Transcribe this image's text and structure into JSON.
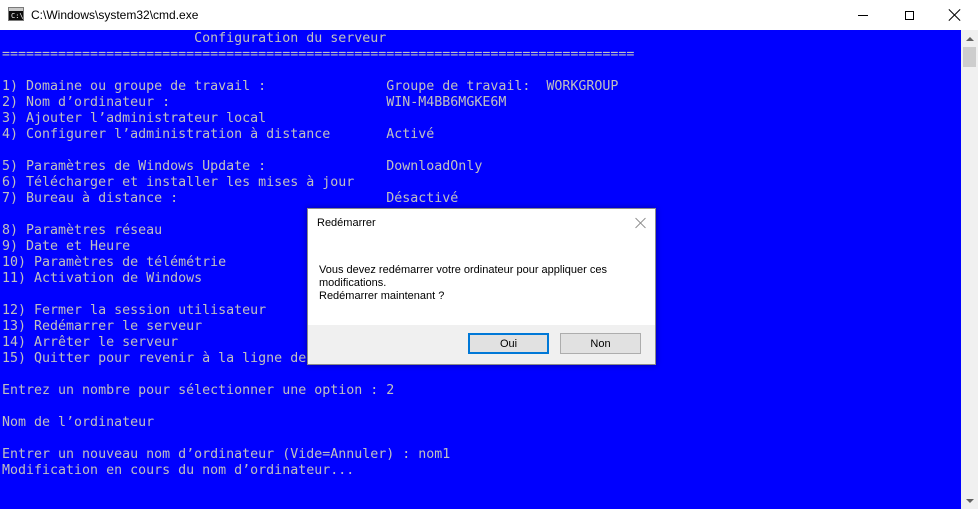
{
  "window": {
    "title": "C:\\Windows\\system32\\cmd.exe",
    "icon": "cmd-console-icon",
    "icon_text": "C:\\."
  },
  "console": {
    "background": "#0000ff",
    "foreground": "#c0c0c0",
    "lines": [
      {
        "row": 0,
        "text": "                        Configuration du serveur"
      },
      {
        "row": 1,
        "text": "==============================================================================="
      },
      {
        "row": 3,
        "text": "1) Domaine ou groupe de travail :               Groupe de travail:  WORKGROUP"
      },
      {
        "row": 4,
        "text": "2) Nom d’ordinateur :                           WIN-M4BB6MGKE6M"
      },
      {
        "row": 5,
        "text": "3) Ajouter l’administrateur local"
      },
      {
        "row": 6,
        "text": "4) Configurer l’administration à distance       Activé"
      },
      {
        "row": 8,
        "text": "5) Paramètres de Windows Update :               DownloadOnly"
      },
      {
        "row": 9,
        "text": "6) Télécharger et installer les mises à jour"
      },
      {
        "row": 10,
        "text": "7) Bureau à distance :                          Désactivé"
      },
      {
        "row": 12,
        "text": "8) Paramètres réseau"
      },
      {
        "row": 13,
        "text": "9) Date et Heure"
      },
      {
        "row": 14,
        "text": "10) Paramètres de télémétrie"
      },
      {
        "row": 15,
        "text": "11) Activation de Windows"
      },
      {
        "row": 17,
        "text": "12) Fermer la session utilisateur"
      },
      {
        "row": 18,
        "text": "13) Redémarrer le serveur"
      },
      {
        "row": 19,
        "text": "14) Arrêter le serveur"
      },
      {
        "row": 20,
        "text": "15) Quitter pour revenir à la ligne de"
      },
      {
        "row": 22,
        "text": "Entrez un nombre pour sélectionner une option : 2"
      },
      {
        "row": 24,
        "text": "Nom de l’ordinateur"
      },
      {
        "row": 26,
        "text": "Entrer un nouveau nom d’ordinateur (Vide=Annuler) : nom1"
      },
      {
        "row": 27,
        "text": "Modification en cours du nom d’ordinateur..."
      }
    ]
  },
  "dialog": {
    "title": "Redémarrer",
    "message_lines": [
      "Vous devez redémarrer votre ordinateur pour appliquer ces",
      "modifications.",
      "Redémarrer maintenant ?"
    ],
    "yes_label": "Oui",
    "no_label": "Non",
    "default_button": "yes",
    "accent": "#0078d7"
  }
}
